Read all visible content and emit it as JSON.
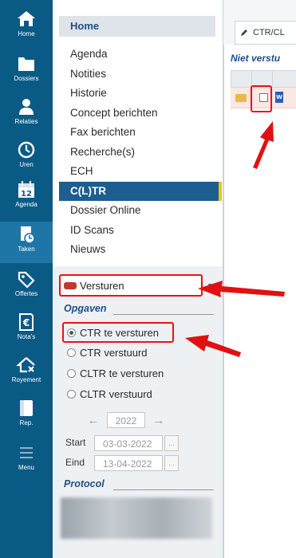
{
  "rail": {
    "items": [
      {
        "label": "Home",
        "icon": "home-icon"
      },
      {
        "label": "Dossiers",
        "icon": "folder-icon"
      },
      {
        "label": "Relaties",
        "icon": "person-icon"
      },
      {
        "label": "Uren",
        "icon": "clock-icon"
      },
      {
        "label": "Agenda",
        "icon": "calendar-icon",
        "day": "12"
      },
      {
        "label": "Taken",
        "icon": "tasks-icon"
      },
      {
        "label": "Offertes",
        "icon": "tag-icon"
      },
      {
        "label": "Nota's",
        "icon": "invoice-icon"
      },
      {
        "label": "Royement",
        "icon": "cancel-house-icon"
      },
      {
        "label": "Rep.",
        "icon": "report-icon"
      },
      {
        "label": "Menu",
        "icon": "menu-icon"
      }
    ]
  },
  "nav": {
    "home": "Home",
    "items": [
      {
        "label": "Agenda"
      },
      {
        "label": "Notities"
      },
      {
        "label": "Historie"
      },
      {
        "label": "Concept berichten"
      },
      {
        "label": "Fax berichten"
      },
      {
        "label": "Recherche(s)"
      },
      {
        "label": "ECH"
      },
      {
        "label": "C(L)TR"
      },
      {
        "label": "Dossier Online"
      },
      {
        "label": "ID Scans"
      },
      {
        "label": "Nieuws"
      }
    ]
  },
  "panel": {
    "versturen": "Versturen",
    "opgaven_title": "Opgaven",
    "options": [
      {
        "label": "CTR te versturen"
      },
      {
        "label": "CTR verstuurd"
      },
      {
        "label": "CLTR te versturen"
      },
      {
        "label": "CLTR verstuurd"
      }
    ],
    "year": "2022",
    "start_label": "Start",
    "start_date": "03-03-2022",
    "end_label": "Eind",
    "end_date": "13-04-2022",
    "date_btn": "...",
    "protocol_title": "Protocol"
  },
  "content": {
    "tab_label": "CTR/CL",
    "filter_label": "Niet verstu"
  },
  "colors": {
    "rail_bg": "#0a5a86",
    "nav_selected": "#1d5d8f",
    "accent": "#f0c419",
    "annotation": "#e11111",
    "title_blue": "#1e4f86"
  }
}
